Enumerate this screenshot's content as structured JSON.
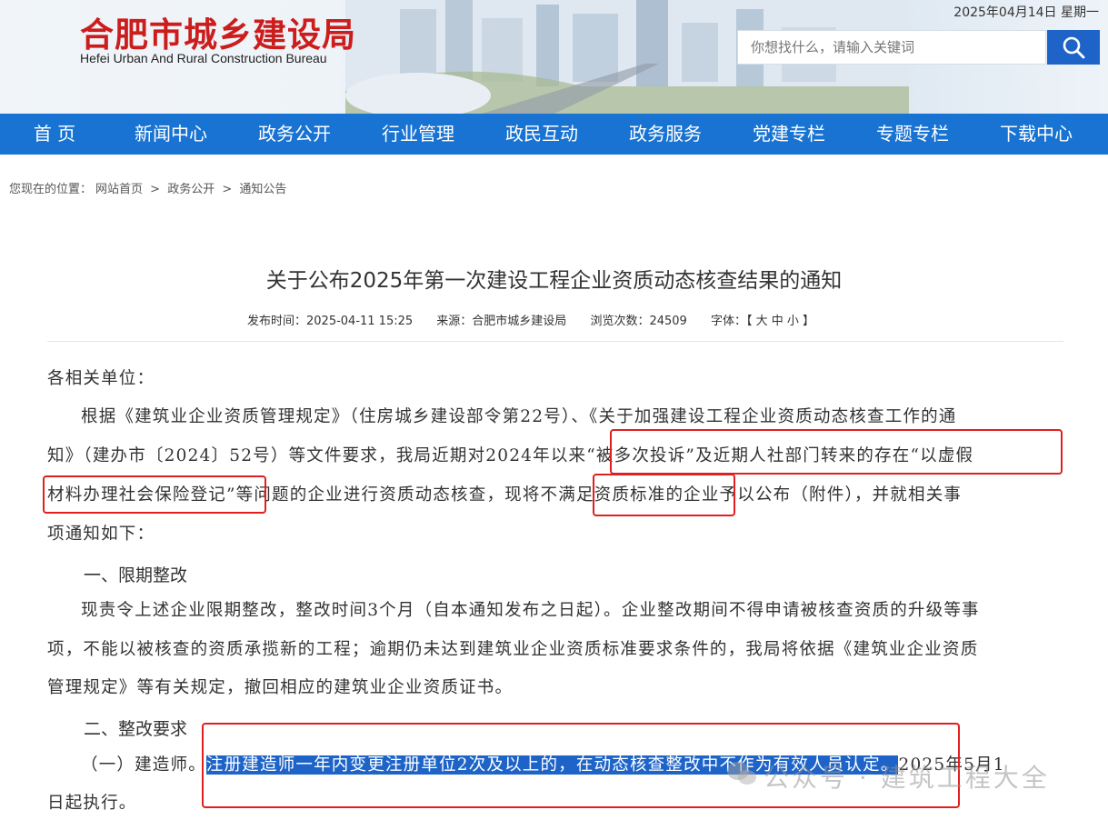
{
  "header": {
    "logo_title": "合肥市城乡建设局",
    "logo_subtitle": "Hefei Urban And Rural Construction Bureau",
    "date": "2025年04月14日 星期一",
    "search_placeholder": "你想找什么，请输入关键词",
    "search_icon": "search-icon"
  },
  "nav": {
    "items": [
      "首 页",
      "新闻中心",
      "政务公开",
      "行业管理",
      "政民互动",
      "政务服务",
      "党建专栏",
      "专题专栏",
      "下载中心"
    ]
  },
  "breadcrumb": {
    "prefix": "您现在的位置：",
    "items": [
      "网站首页",
      ">",
      "政务公开",
      ">",
      "通知公告"
    ]
  },
  "article": {
    "title": "关于公布2025年第一次建设工程企业资质动态核查结果的通知",
    "meta": {
      "publish_time": "发布时间：2025-04-11 15:25",
      "source": "来源：合肥市城乡建设局",
      "views": "浏览次数：24509",
      "font_label": "字体：【 大 中 小 】"
    },
    "salutation": "各相关单位：",
    "para1_line1": "根据《建筑业企业资质管理规定》（住房城乡建设部令第22号）、《关于加强建设工程企业资质动态核查工作的通",
    "para1_line2": "知》（建办市〔2024〕52号）等文件要求，我局近期对2024年以来“被多次投诉”及近期人社部门转来的存在“以虚假",
    "para1_line3": "材料办理社会保险登记”等问题的企业进行资质动态核查，现将不满足资质标准的企业予以公布（附件），并就相关事",
    "para1_line4": "项通知如下：",
    "section1_title": "一、限期整改",
    "para2_line1": "现责令上述企业限期整改，整改时间3个月（自本通知发布之日起）。企业整改期间不得申请被核查资质的升级等事",
    "para2_line2": "项，不能以被核查的资质承揽新的工程；逾期仍未达到建筑业企业资质标准要求条件的，我局将依据《建筑业企业资质",
    "para2_line3": "管理规定》等有关规定，撤回相应的建筑业企业资质证书。",
    "section2_title": "二、整改要求",
    "para3_prefix": "（一）建造师。",
    "para3_highlight": "注册建造师一年内变更注册单位2次及以上的，在动态核查整改中不作为有效人员认定。",
    "para3_suffix": "2025年5月1",
    "para3_line2": "日起执行。"
  },
  "watermark": "公众号 · 建筑工程大全",
  "colors": {
    "brand_red": "#cc1d1d",
    "nav_blue": "#1873d2",
    "highlight_blue": "#1e64c8",
    "annotation_red": "#e02020"
  }
}
